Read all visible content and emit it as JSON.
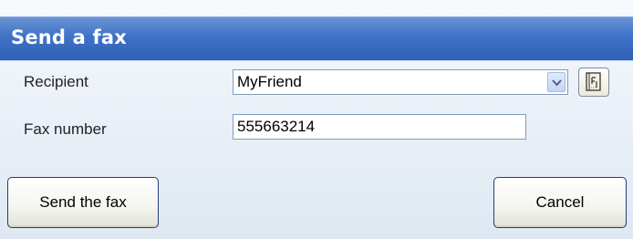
{
  "window": {
    "title": "Send a fax"
  },
  "form": {
    "recipient_label": "Recipient",
    "recipient_value": "MyFriend",
    "fax_number_label": "Fax number",
    "fax_number_value": "555663214"
  },
  "buttons": {
    "send_label": "Send the fax",
    "cancel_label": "Cancel"
  },
  "icons": {
    "combo_dropdown": "chevron-down-icon",
    "address_book": "address-book-icon"
  },
  "colors": {
    "titlebar": "#3f72c6",
    "title_text": "#ffffff",
    "field_border": "#7f9db9",
    "button_border": "#1e3f7a"
  }
}
